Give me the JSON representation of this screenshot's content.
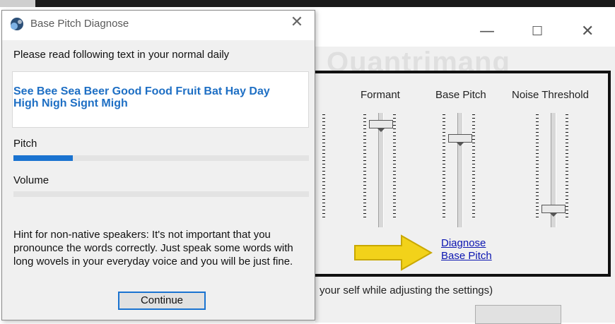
{
  "dialog": {
    "title": "Base Pitch Diagnose",
    "close_icon": "close-icon",
    "instruction": "Please read following text in your normal daily",
    "read_text": "See Bee Sea Beer Good Food Fruit Bat Hay Day High Nigh Signt Migh",
    "pitch_label": "Pitch",
    "pitch_level": 0.2,
    "volume_label": "Volume",
    "volume_level": 0,
    "hint": "Hint for non-native speakers: It's not important that you pronounce the words correctly. Just speak some words with long wovels in your everyday voice and you will be just fine.",
    "continue_label": "Continue"
  },
  "background_window": {
    "partial_label": ":",
    "columns": [
      "Formant",
      "Base Pitch",
      "Noise Threshold"
    ],
    "slider_levels": {
      "formant": 0.95,
      "base_pitch": 0.8,
      "noise_threshold": 0.2
    },
    "diagnose_link": "Diagnose\nBase Pitch",
    "status_text": "your self while adjusting the settings)",
    "minimize_icon": "minimize-icon",
    "maximize_icon": "maximize-icon",
    "close_icon": "close-icon"
  },
  "watermark": "Quantrimang",
  "colors": {
    "accent": "#1a73d0",
    "text_blue": "#1e6fc4",
    "link": "#0a14b0",
    "arrow": "#f2d21a"
  }
}
